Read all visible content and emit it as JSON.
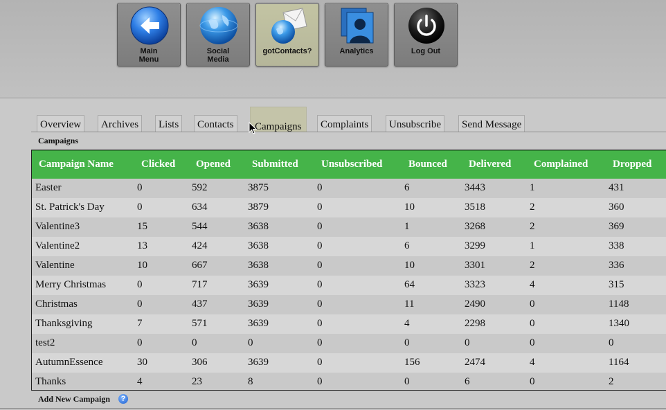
{
  "nav": [
    {
      "label": "Main\nMenu",
      "icon": "back-arrow-icon"
    },
    {
      "label": "Social\nMedia",
      "icon": "globe-icon"
    },
    {
      "label": "gotContacts?",
      "icon": "globe-envelope-icon"
    },
    {
      "label": "Analytics",
      "icon": "people-icon"
    },
    {
      "label": "Log Out",
      "icon": "power-icon"
    }
  ],
  "tabs": [
    "Overview",
    "Archives",
    "Lists",
    "Contacts",
    "Campaigns",
    "Complaints",
    "Unsubscribe",
    "Send Message"
  ],
  "active_tab": "Campaigns",
  "section_label": "Campaigns",
  "table": {
    "headers": [
      "Campaign Name",
      "Clicked",
      "Opened",
      "Submitted",
      "Unsubscribed",
      "Bounced",
      "Delivered",
      "Complained",
      "Dropped"
    ],
    "rows": [
      [
        "Easter",
        "0",
        "592",
        "3875",
        "0",
        "6",
        "3443",
        "1",
        "431"
      ],
      [
        "St. Patrick's Day",
        "0",
        "634",
        "3879",
        "0",
        "10",
        "3518",
        "2",
        "360"
      ],
      [
        "Valentine3",
        "15",
        "544",
        "3638",
        "0",
        "1",
        "3268",
        "2",
        "369"
      ],
      [
        "Valentine2",
        "13",
        "424",
        "3638",
        "0",
        "6",
        "3299",
        "1",
        "338"
      ],
      [
        "Valentine",
        "10",
        "667",
        "3638",
        "0",
        "10",
        "3301",
        "2",
        "336"
      ],
      [
        "Merry Christmas",
        "0",
        "717",
        "3639",
        "0",
        "64",
        "3323",
        "4",
        "315"
      ],
      [
        "Christmas",
        "0",
        "437",
        "3639",
        "0",
        "11",
        "2490",
        "0",
        "1148"
      ],
      [
        "Thanksgiving",
        "7",
        "571",
        "3639",
        "0",
        "4",
        "2298",
        "0",
        "1340"
      ],
      [
        "test2",
        "0",
        "0",
        "0",
        "0",
        "0",
        "0",
        "0",
        "0"
      ],
      [
        "AutumnEssence",
        "30",
        "306",
        "3639",
        "0",
        "156",
        "2474",
        "4",
        "1164"
      ],
      [
        "Thanks",
        "4",
        "23",
        "8",
        "0",
        "0",
        "6",
        "0",
        "2"
      ]
    ]
  },
  "footer": {
    "add_label": "Add New Campaign",
    "help_glyph": "?"
  },
  "colors": {
    "header_green": "#45b449",
    "active_tab": "#c4c4a9",
    "active_nav": "#c3c4a3"
  }
}
